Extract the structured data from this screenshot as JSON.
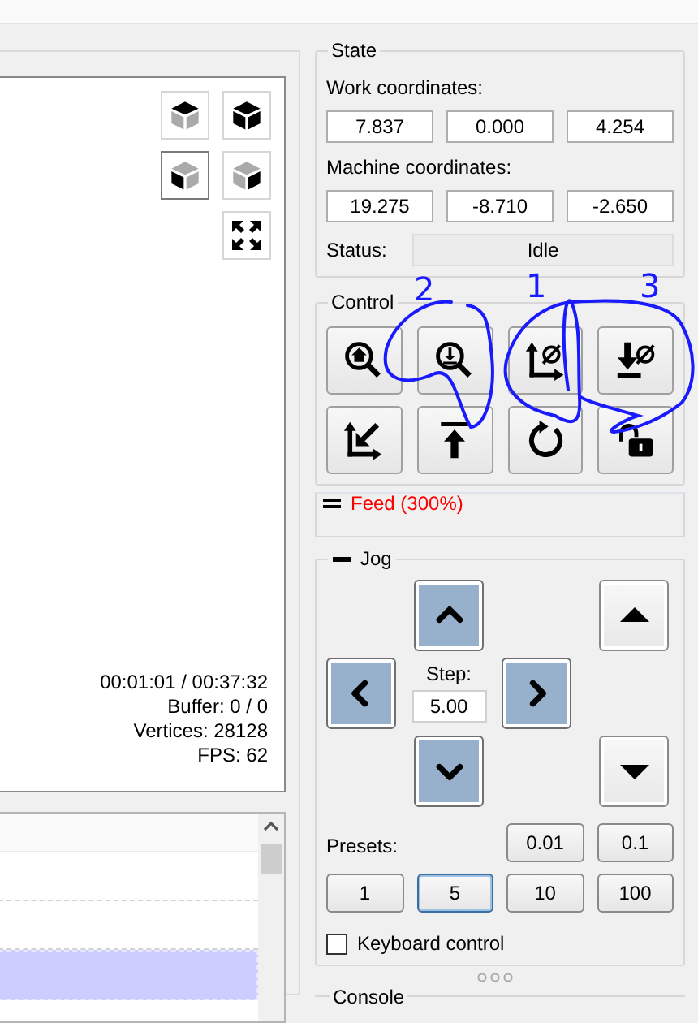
{
  "viewport": {
    "view_buttons": [
      {
        "kind": "top",
        "selected": false
      },
      {
        "kind": "all",
        "selected": false
      },
      {
        "kind": "left",
        "selected": true
      },
      {
        "kind": "right",
        "selected": false
      },
      {
        "kind": "fit",
        "selected": false
      }
    ],
    "stats": [
      "00:01:01 / 00:37:32",
      "Buffer: 0 / 0",
      "Vertices: 28128",
      "FPS: 62"
    ]
  },
  "gcode_table": {
    "rows": [
      {
        "selected": false
      },
      {
        "selected": false
      },
      {
        "selected": true
      }
    ]
  },
  "state": {
    "title": "State",
    "work_label": "Work coordinates:",
    "work": [
      "7.837",
      "0.000",
      "4.254"
    ],
    "machine_label": "Machine coordinates:",
    "machine": [
      "19.275",
      "-8.710",
      "-2.650"
    ],
    "status_label": "Status:",
    "status": "Idle"
  },
  "control": {
    "title": "Control",
    "buttons": [
      {
        "kind": "home"
      },
      {
        "kind": "probe"
      },
      {
        "kind": "zero-xy"
      },
      {
        "kind": "zero-z"
      },
      {
        "kind": "restore"
      },
      {
        "kind": "safe"
      },
      {
        "kind": "reset"
      },
      {
        "kind": "unlock"
      }
    ]
  },
  "feed": {
    "title": "Feed (300%)"
  },
  "jog": {
    "title": "Jog",
    "buttons": [
      {
        "kind": "y-plus"
      },
      {
        "kind": "z-plus"
      },
      {
        "kind": "x-minus"
      },
      {
        "kind": "x-plus"
      },
      {
        "kind": "y-minus"
      },
      {
        "kind": "z-minus"
      }
    ],
    "step_label": "Step:",
    "step": "5.00",
    "presets_label": "Presets:",
    "presets": [
      {
        "label": "0.01",
        "selected": false
      },
      {
        "label": "0.1",
        "selected": false
      },
      {
        "label": "1",
        "selected": false
      },
      {
        "label": "5",
        "selected": true
      },
      {
        "label": "10",
        "selected": false
      },
      {
        "label": "100",
        "selected": false
      }
    ],
    "keyboard_control": {
      "label": "Keyboard control",
      "checked": false
    }
  },
  "console": {
    "title": "Console"
  },
  "annotations": [
    {
      "label": "2"
    },
    {
      "label": "1"
    },
    {
      "label": "3"
    }
  ]
}
